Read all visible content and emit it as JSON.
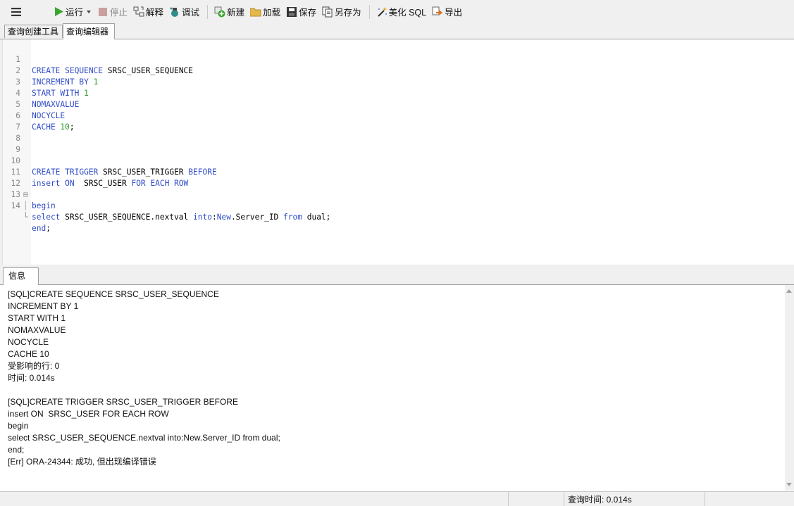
{
  "toolbar": {
    "menu_icon": "hamburger-icon",
    "run": "运行",
    "stop": "停止",
    "explain": "解释",
    "debug": "调试",
    "new": "新建",
    "load": "加载",
    "save": "保存",
    "save_as": "另存为",
    "beautify": "美化 SQL",
    "export": "导出"
  },
  "tabs": {
    "query_builder": "查询创建工具",
    "query_editor": "查询编辑器"
  },
  "editor": {
    "line_numbers": [
      "1",
      "2",
      "3",
      "4",
      "5",
      "6",
      "7",
      "8",
      "9",
      "10",
      "11",
      "12",
      "13",
      "14"
    ],
    "fold_begin": "⊟",
    "fold_end": "└",
    "tokens": {
      "l1a": "CREATE SEQUENCE",
      "l1b": " SRSC_USER_SEQUENCE",
      "l2a": "INCREMENT BY",
      "l2b": " 1",
      "l3a": "START WITH",
      "l3b": " 1",
      "l4a": "NOMAXVALUE",
      "l5a": "NOCYCLE",
      "l6a": "CACHE",
      "l6b": " 10",
      "l6c": ";",
      "l10a": "CREATE TRIGGER",
      "l10b": " SRSC_USER_TRIGGER ",
      "l10c": "BEFORE",
      "l11a": "insert ON",
      "l11b": "  SRSC_USER ",
      "l11c": "FOR EACH ROW",
      "l12a": "begin",
      "l13a": "select",
      "l13b": " SRSC_USER_SEQUENCE.nextval ",
      "l13c": "into",
      "l13d": ":",
      "l13e": "New",
      "l13f": ".Server_ID ",
      "l13g": "from",
      "l13h": " dual;",
      "l14a": "end",
      "l14b": ";"
    }
  },
  "info": {
    "tab_label": "信息",
    "lines": [
      "[SQL]CREATE SEQUENCE SRSC_USER_SEQUENCE",
      "INCREMENT BY 1",
      "START WITH 1",
      "NOMAXVALUE",
      "NOCYCLE",
      "CACHE 10",
      "受影响的行: 0",
      "时间: 0.014s",
      "",
      "[SQL]CREATE TRIGGER SRSC_USER_TRIGGER BEFORE",
      "insert ON  SRSC_USER FOR EACH ROW",
      "begin",
      "select SRSC_USER_SEQUENCE.nextval into:New.Server_ID from dual;",
      "end;",
      "[Err] ORA-24344: 成功, 但出现编译错误"
    ]
  },
  "status": {
    "query_time": "查询时间: 0.014s"
  },
  "colors": {
    "keyword": "#2f4cc9",
    "number": "#2e9a2e",
    "run_icon": "#3aa62f",
    "stop_icon": "#c9a0a0"
  }
}
